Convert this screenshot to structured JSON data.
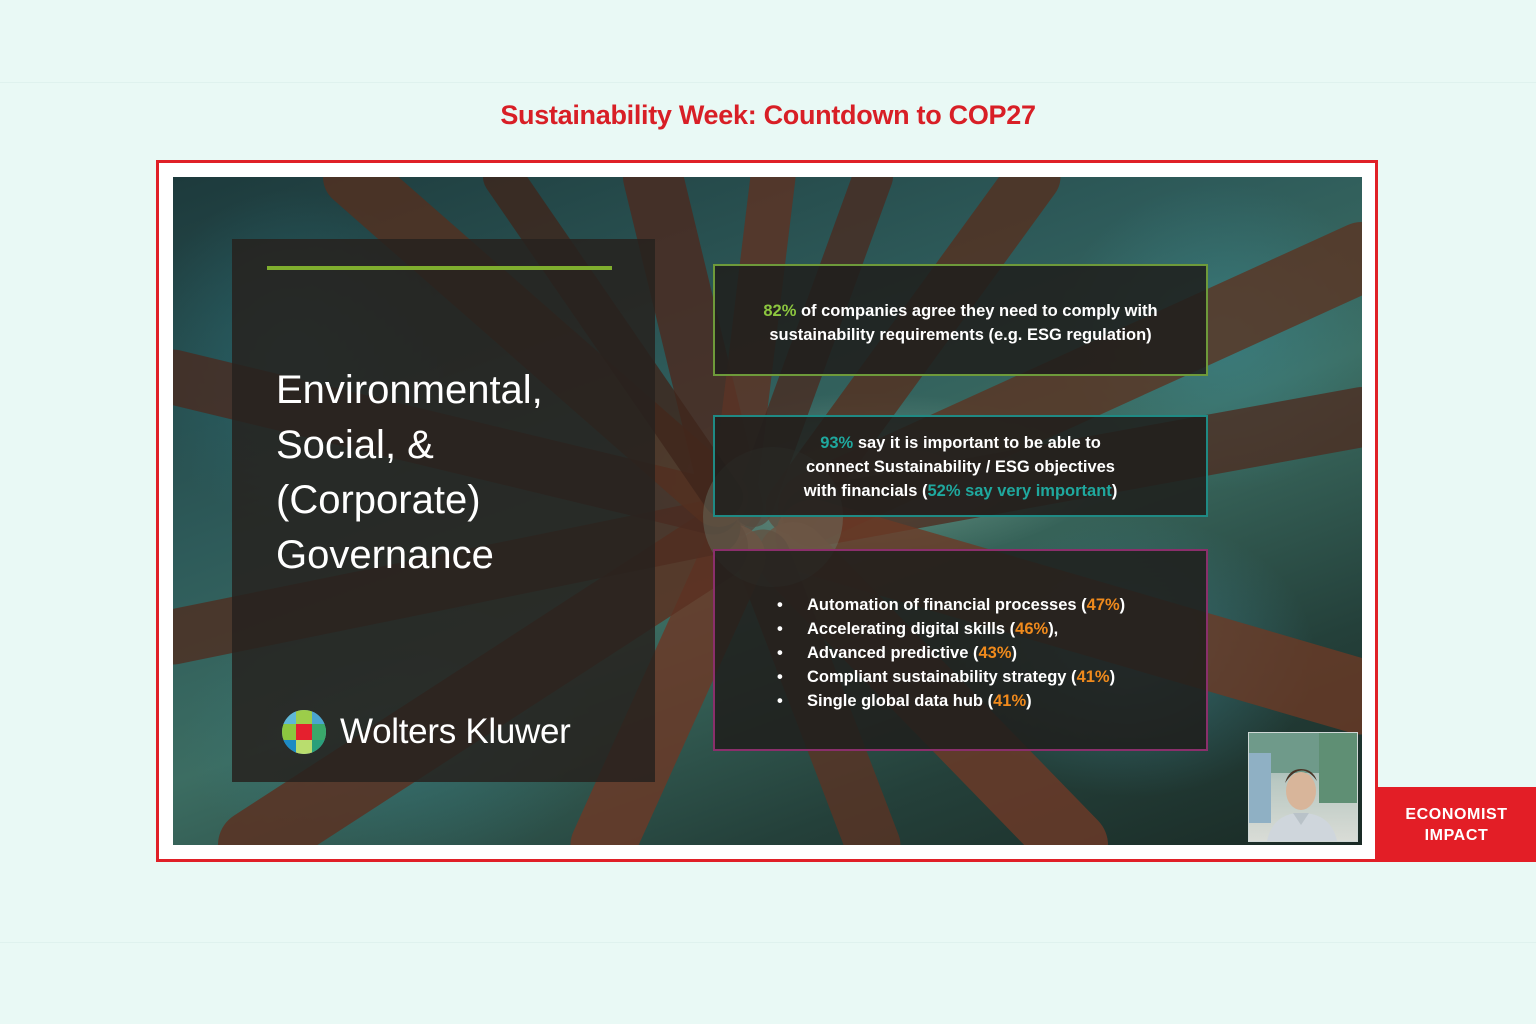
{
  "event": {
    "title": "Sustainability Week: Countdown to COP27",
    "title_color": "#d81f26"
  },
  "slide": {
    "heading_lines": [
      "Environmental,",
      "Social, &",
      "(Corporate)",
      "Governance"
    ],
    "accent_color": "#7fae2e",
    "logo_text": "Wolters Kluwer",
    "logo_icon": "wolters-kluwer-logo-icon",
    "stat1": {
      "highlight": "82%",
      "text_line1": " of companies agree they need to comply with",
      "text_line2": "sustainability requirements (e.g. ESG regulation)",
      "highlight_color": "#8cc63f"
    },
    "stat2": {
      "highlight": "93%",
      "text_line1": " say it is important to be able to",
      "text_line2": "connect Sustainability / ESG objectives",
      "text_line3_prefix": "with financials (",
      "sub_highlight": "52% say very important",
      "text_line3_suffix": ")",
      "highlight_color": "#1fa89e"
    },
    "priorities": {
      "highlight_color": "#f08a1c",
      "items": [
        {
          "label": "Automation of financial processes (",
          "pct": "47%",
          "suffix": ")"
        },
        {
          "label": "Accelerating digital skills (",
          "pct": "46%",
          "suffix": "),"
        },
        {
          "label": "Advanced predictive (",
          "pct": "43%",
          "suffix": ")"
        },
        {
          "label": "Compliant sustainability strategy (",
          "pct": "41%",
          "suffix": ")"
        },
        {
          "label": "Single global data hub (",
          "pct": "41%",
          "suffix": ")"
        }
      ]
    }
  },
  "brand": {
    "line1": "ECONOMIST",
    "line2": "IMPACT",
    "color": "#e31e26"
  },
  "webcam": {
    "icon": "presenter-video-thumbnail"
  }
}
